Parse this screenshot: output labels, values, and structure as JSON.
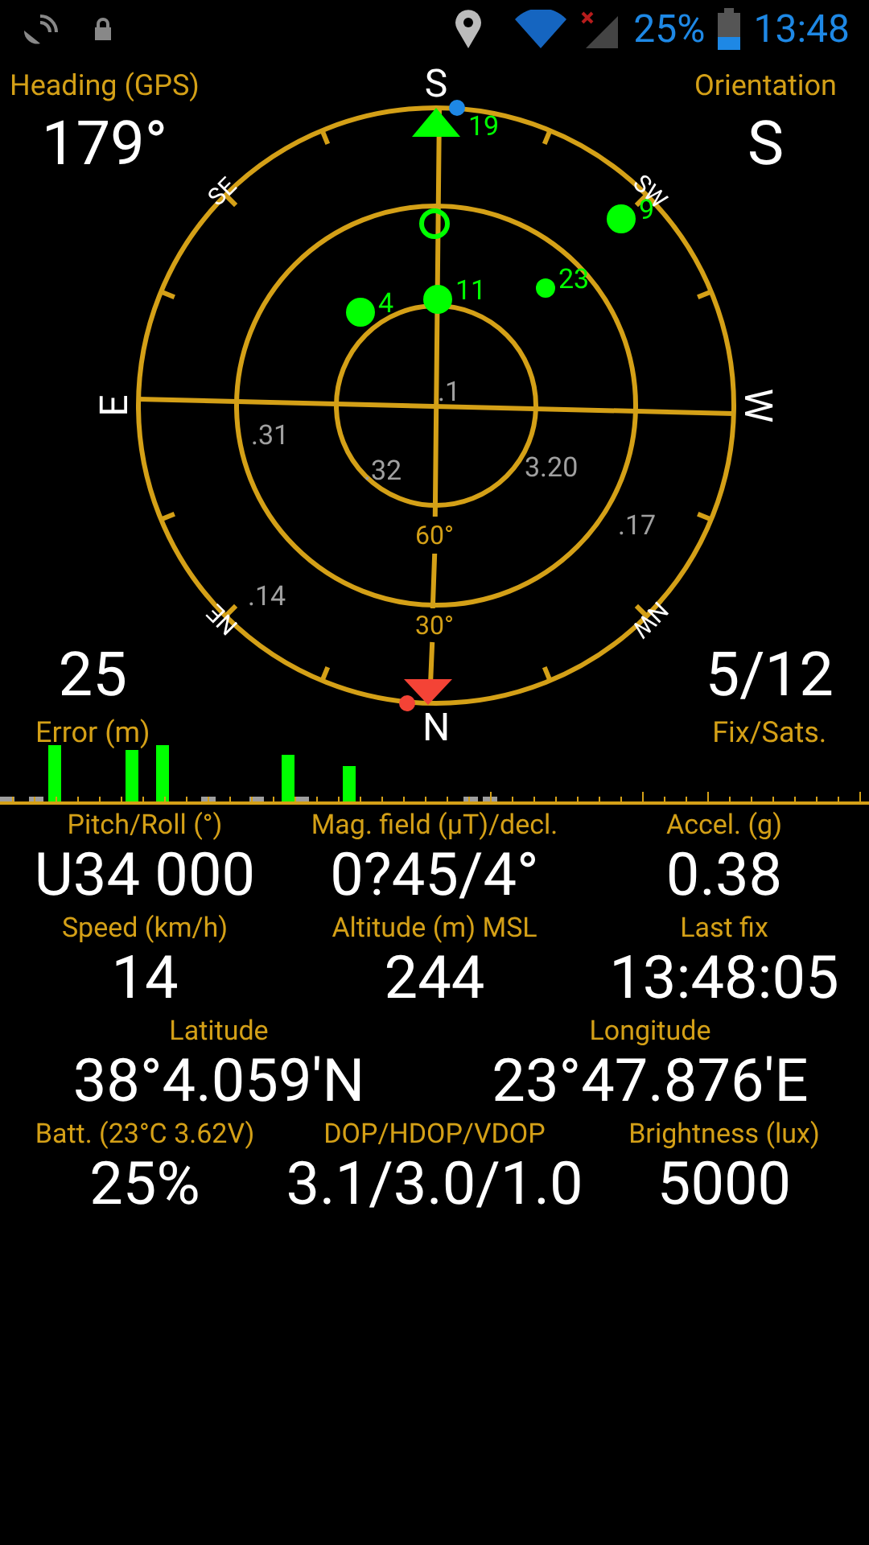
{
  "status_bar": {
    "battery_text": "25%",
    "time": "13:48"
  },
  "heading": {
    "label": "Heading (GPS)",
    "value": "179°"
  },
  "orientation": {
    "label": "Orientation",
    "value": "S"
  },
  "error": {
    "label": "Error (m)",
    "value": "25"
  },
  "fix": {
    "label": "Fix/Sats.",
    "value": "5/12"
  },
  "sky_plot": {
    "directions": [
      "S",
      "SW",
      "W",
      "NW",
      "N",
      "NE",
      "E",
      "SE"
    ],
    "ring_labels": [
      "60°",
      "30°"
    ],
    "satellites": [
      {
        "kind": "triangle",
        "label": "19",
        "color": "#00ff00"
      },
      {
        "kind": "dot",
        "color": "#1e88e5"
      },
      {
        "kind": "ring",
        "color": "#00ff00"
      },
      {
        "kind": "dot",
        "label": "4",
        "color": "#00ff00"
      },
      {
        "kind": "dot",
        "label": "11",
        "color": "#00ff00"
      },
      {
        "kind": "small",
        "label": "23",
        "color": "#00ff00"
      },
      {
        "kind": "dot",
        "label": "9",
        "color": "#00ff00"
      },
      {
        "kind": "label",
        "label": ".1",
        "color": "#a0a0a0"
      },
      {
        "kind": "label",
        "label": ".31",
        "color": "#a0a0a0"
      },
      {
        "kind": "label",
        "label": ".32",
        "color": "#a0a0a0"
      },
      {
        "kind": "label",
        "label": "3.20",
        "color": "#a0a0a0"
      },
      {
        "kind": "label",
        "label": ".17",
        "color": "#a0a0a0"
      },
      {
        "kind": "label",
        "label": ".14",
        "color": "#a0a0a0"
      },
      {
        "kind": "pointer",
        "color": "#f44336"
      },
      {
        "kind": "dot",
        "color": "#f44336"
      }
    ]
  },
  "readings": [
    [
      {
        "label": "Pitch/Roll (°)",
        "value": "U34 000"
      },
      {
        "label": "Mag. field (µT)/decl.",
        "value": "0?45/4°"
      },
      {
        "label": "Accel. (g)",
        "value": "0.38"
      }
    ],
    [
      {
        "label": "Speed (km/h)",
        "value": "14"
      },
      {
        "label": "Altitude (m) MSL",
        "value": "244"
      },
      {
        "label": "Last fix",
        "value": "13:48:05"
      }
    ],
    [
      {
        "label": "Latitude",
        "value": "38°4.059'N"
      },
      {
        "label": "Longitude",
        "value": "23°47.876'E"
      }
    ],
    [
      {
        "label": "Batt. (23°C 3.62V)",
        "value": "25%"
      },
      {
        "label": "DOP/HDOP/VDOP",
        "value": "3.1/3.0/1.0"
      },
      {
        "label": "Brightness (lux)",
        "value": "5000"
      }
    ]
  ]
}
